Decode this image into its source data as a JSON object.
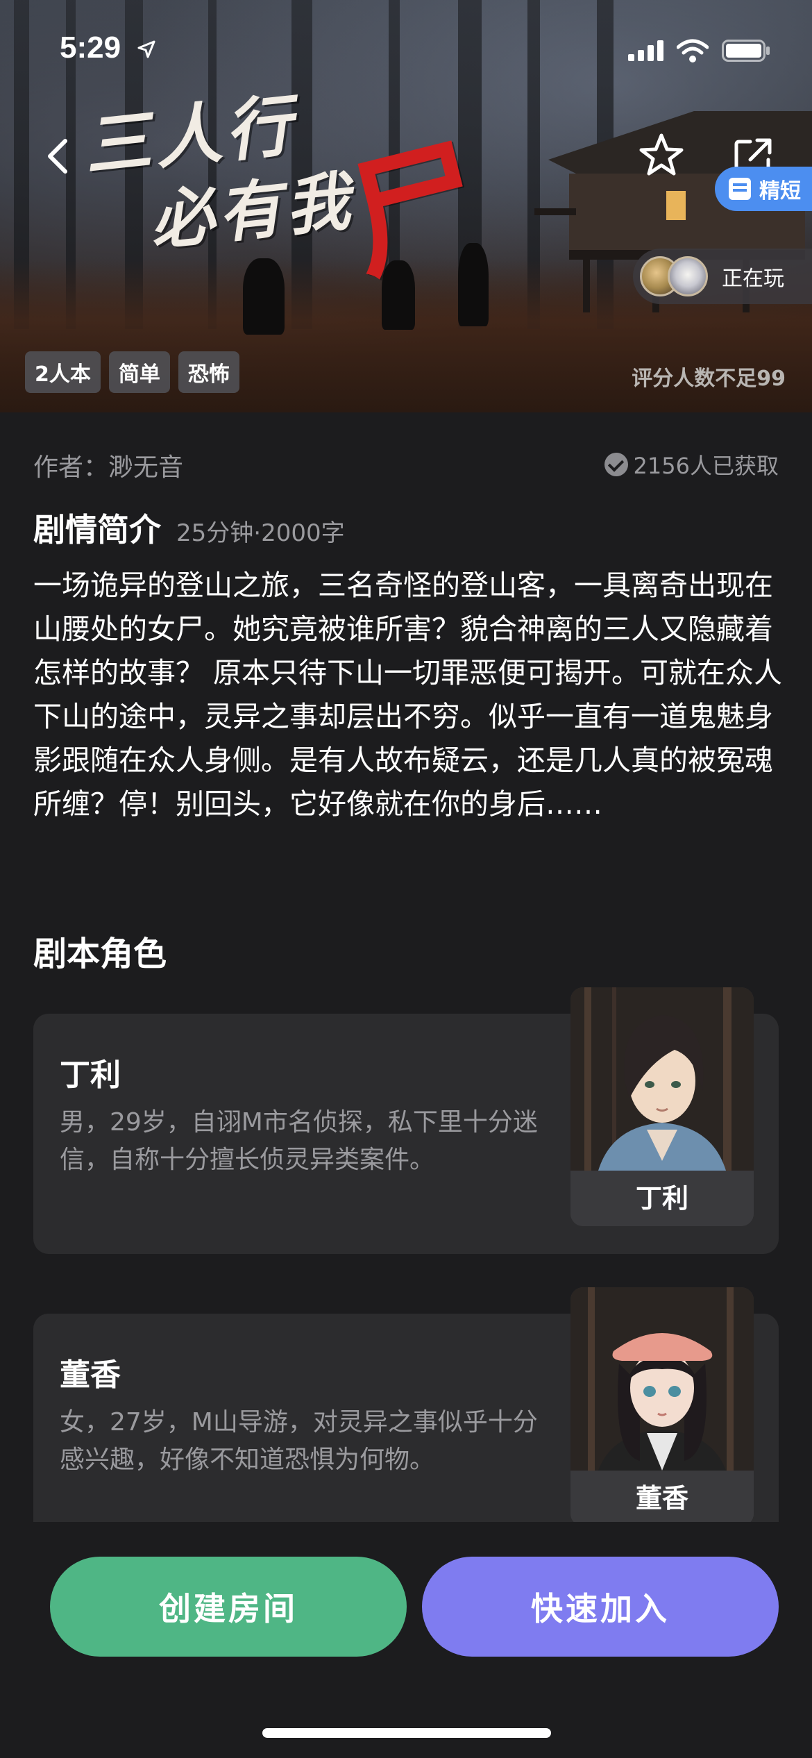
{
  "status_bar": {
    "time": "5:29"
  },
  "hero": {
    "title_line1": "三人行",
    "title_line2": "必有我",
    "title_accent": "尸",
    "badge": "精短",
    "playing_label": "正在玩",
    "tags": [
      "2人本",
      "简单",
      "恐怖"
    ],
    "rating_note": "评分人数不足99"
  },
  "info": {
    "author": "作者：渺无音",
    "obtained": "2156人已获取",
    "synopsis_title": "剧情简介",
    "synopsis_meta": "25分钟·2000字",
    "synopsis": "一场诡异的登山之旅，三名奇怪的登山客，一具离奇出现在山腰处的女尸。她究竟被谁所害？貌合神离的三人又隐藏着怎样的故事？ 原本只待下山一切罪恶便可揭开。可就在众人下山的途中，灵异之事却层出不穷。似乎一直有一道鬼魅身影跟随在众人身侧。是有人故布疑云，还是几人真的被冤魂所缠？停！别回头，它好像就在你的身后……"
  },
  "roles": {
    "title": "剧本角色",
    "items": [
      {
        "name": "丁利",
        "desc": "男，29岁，自诩M市名侦探，私下里十分迷信，自称十分擅长侦灵异类案件。",
        "portrait_label": "丁利"
      },
      {
        "name": "董香",
        "desc": "女，27岁，M山导游，对灵异之事似乎十分感兴趣，好像不知道恐惧为何物。",
        "portrait_label": "董香"
      }
    ]
  },
  "actions": {
    "create": "创建房间",
    "join": "快速加入"
  },
  "colors": {
    "create": "#4fb685",
    "join": "#7f7cf0",
    "badge": "#4c8ef0",
    "accent_red": "#d11f1f"
  }
}
